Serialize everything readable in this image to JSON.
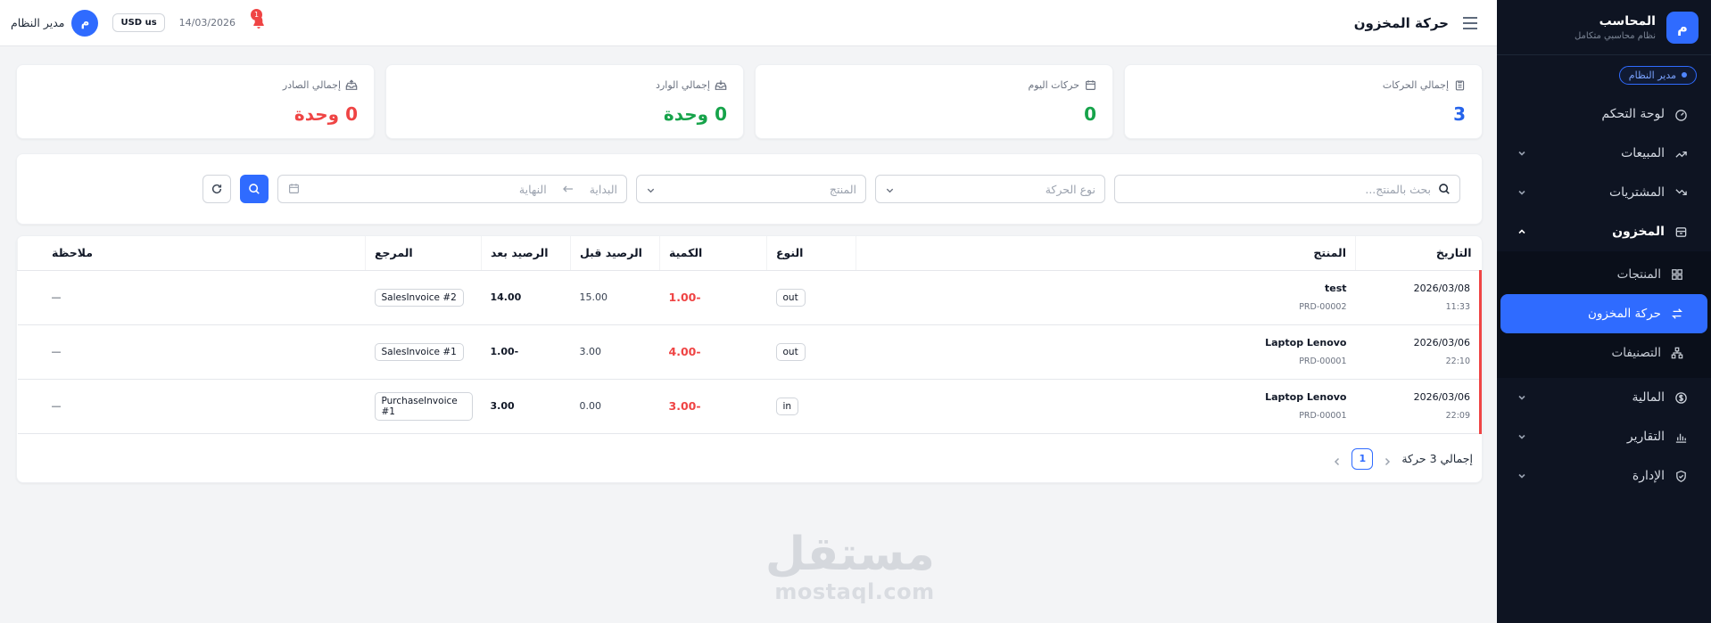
{
  "sidebar": {
    "brand_initial": "م",
    "brand_name": "المحاسب",
    "brand_subtitle": "نظام محاسبي متكامل",
    "role_badge": "مدير النظام",
    "items": [
      {
        "label": "لوحة التحكم",
        "icon": "dashboard-icon"
      },
      {
        "label": "المبيعات",
        "icon": "trend-up-icon"
      },
      {
        "label": "المشتريات",
        "icon": "trend-down-icon"
      },
      {
        "label": "المخزون",
        "icon": "archive-icon"
      },
      {
        "label": "المالية",
        "icon": "dollar-icon"
      },
      {
        "label": "التقارير",
        "icon": "bar-chart-icon"
      },
      {
        "label": "الإدارة",
        "icon": "shield-icon"
      }
    ],
    "inventory_sub": [
      {
        "label": "المنتجات",
        "icon": "grid-icon"
      },
      {
        "label": "حركة المخزون",
        "icon": "swap-icon"
      },
      {
        "label": "التصنيفات",
        "icon": "sitemap-icon"
      }
    ]
  },
  "topbar": {
    "title": "حركة المخزون",
    "user_initial": "م",
    "user_name": "مدير النظام",
    "currency": "USD us",
    "date": "14/03/2026",
    "notifications": "1"
  },
  "stats": [
    {
      "label": "إجمالي الحركات",
      "value": "3",
      "color": "#2563eb",
      "icon": "clipboard-icon"
    },
    {
      "label": "حركات اليوم",
      "value": "0",
      "color": "#16a34a",
      "icon": "calendar-icon"
    },
    {
      "label": "إجمالي الوارد",
      "value": "0 وحدة",
      "color": "#16a34a",
      "icon": "inbox-in-icon"
    },
    {
      "label": "إجمالي الصادر",
      "value": "0 وحدة",
      "color": "#ef4444",
      "icon": "inbox-out-icon"
    }
  ],
  "filters": {
    "search_placeholder": "بحث بالمنتج...",
    "type_placeholder": "نوع الحركة",
    "product_placeholder": "المنتج",
    "start_placeholder": "البداية",
    "end_placeholder": "النهاية"
  },
  "table": {
    "headers": {
      "date": "التاريخ",
      "product": "المنتج",
      "type": "النوع",
      "qty": "الكمية",
      "before": "الرصيد قبل",
      "after": "الرصيد بعد",
      "ref": "المرجع",
      "note": "ملاحظة"
    },
    "rows": [
      {
        "date": "2026/03/08",
        "time": "11:33",
        "product": "test",
        "code": "PRD-00002",
        "type": "out",
        "qty": "-1.00",
        "before": "15.00",
        "after": "14.00",
        "ref": "SalesInvoice #2",
        "note": "—"
      },
      {
        "date": "2026/03/06",
        "time": "22:10",
        "product": "Laptop Lenovo",
        "code": "PRD-00001",
        "type": "out",
        "qty": "-4.00",
        "before": "3.00",
        "after": "-1.00",
        "ref": "SalesInvoice #1",
        "note": "—"
      },
      {
        "date": "2026/03/06",
        "time": "22:09",
        "product": "Laptop Lenovo",
        "code": "PRD-00001",
        "type": "in",
        "qty": "-3.00",
        "before": "0.00",
        "after": "3.00",
        "ref": "PurchaseInvoice #1",
        "note": "—"
      }
    ]
  },
  "pager": {
    "total": "إجمالي 3 حركة",
    "page": "1"
  },
  "watermark": {
    "logo": "مستقل",
    "url": "mostaql.com"
  }
}
